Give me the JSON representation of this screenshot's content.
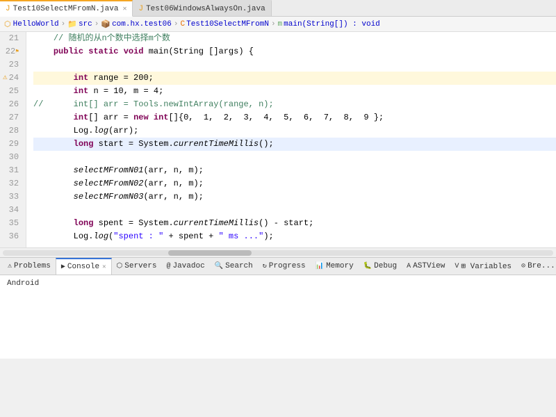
{
  "tabs": [
    {
      "id": "tab1",
      "label": "Test10SelectMFromN.java",
      "icon": "J",
      "active": true,
      "closable": true
    },
    {
      "id": "tab2",
      "label": "Test06WindowsAlwaysOn.java",
      "icon": "J",
      "active": false,
      "closable": false
    }
  ],
  "breadcrumb": {
    "items": [
      {
        "label": "HelloWorld",
        "type": "project"
      },
      {
        "label": "src",
        "type": "folder"
      },
      {
        "label": "com.hx.test06",
        "type": "package"
      },
      {
        "label": "Test10SelectMFromN",
        "type": "class"
      },
      {
        "label": "main(String[]) : void",
        "type": "method"
      }
    ]
  },
  "code_lines": [
    {
      "num": "21",
      "content": "    // 随机的从n个数中选择m个数",
      "type": "comment_line"
    },
    {
      "num": "22",
      "content": "    public static void main(String []args) {",
      "type": "normal"
    },
    {
      "num": "23",
      "content": "",
      "type": "normal"
    },
    {
      "num": "24",
      "content": "        int range = 200;",
      "type": "highlighted"
    },
    {
      "num": "25",
      "content": "        int n = 10, m = 4;",
      "type": "normal"
    },
    {
      "num": "26",
      "content": "//      int[] arr = Tools.newIntArray(range, n);",
      "type": "comment_line"
    },
    {
      "num": "27",
      "content": "        int[] arr = new int[]{0,  1,  2,  3,  4,  5,  6,  7,  8,  9 };",
      "type": "normal"
    },
    {
      "num": "28",
      "content": "        Log.log(arr);",
      "type": "normal"
    },
    {
      "num": "29",
      "content": "        long start = System.currentTimeMillis();",
      "type": "current"
    },
    {
      "num": "30",
      "content": "",
      "type": "normal"
    },
    {
      "num": "31",
      "content": "        selectMFromN01(arr, n, m);",
      "type": "normal"
    },
    {
      "num": "32",
      "content": "        selectMFromN02(arr, n, m);",
      "type": "normal"
    },
    {
      "num": "33",
      "content": "        selectMFromN03(arr, n, m);",
      "type": "normal"
    },
    {
      "num": "34",
      "content": "",
      "type": "normal"
    },
    {
      "num": "35",
      "content": "        long spent = System.currentTimeMillis() - start;",
      "type": "normal"
    },
    {
      "num": "36",
      "content": "        Log.log(\"spent : \" + spent + \" ms ...\");",
      "type": "normal"
    }
  ],
  "bottom_tabs": [
    {
      "id": "problems",
      "label": "Problems",
      "icon": "⚠",
      "active": false,
      "closable": false
    },
    {
      "id": "console",
      "label": "Console",
      "icon": "▶",
      "active": true,
      "closable": true
    },
    {
      "id": "servers",
      "label": "Servers",
      "icon": "🖥",
      "active": false,
      "closable": false
    },
    {
      "id": "javadoc",
      "label": "Javadoc",
      "icon": "@",
      "active": false,
      "closable": false
    },
    {
      "id": "search",
      "label": "Search",
      "icon": "🔍",
      "active": false,
      "closable": false
    },
    {
      "id": "progress",
      "label": "Progress",
      "icon": "↻",
      "active": false,
      "closable": false
    },
    {
      "id": "memory",
      "label": "Memory",
      "icon": "M",
      "active": false,
      "closable": false
    },
    {
      "id": "debug",
      "label": "Debug",
      "icon": "🐛",
      "active": false,
      "closable": false
    },
    {
      "id": "astview",
      "label": "ASTView",
      "icon": "A",
      "active": false,
      "closable": false
    },
    {
      "id": "variables",
      "label": "Variables",
      "icon": "V",
      "active": false,
      "closable": false
    },
    {
      "id": "breakpoints",
      "label": "Bre...",
      "icon": "B",
      "active": false,
      "closable": false
    }
  ],
  "console_content": "Android",
  "colors": {
    "keyword": "#7f0055",
    "comment": "#3f7f5f",
    "string": "#2a00ff",
    "tab_active_border": "#f5a623",
    "bottom_tab_active_border": "#3874d8"
  }
}
